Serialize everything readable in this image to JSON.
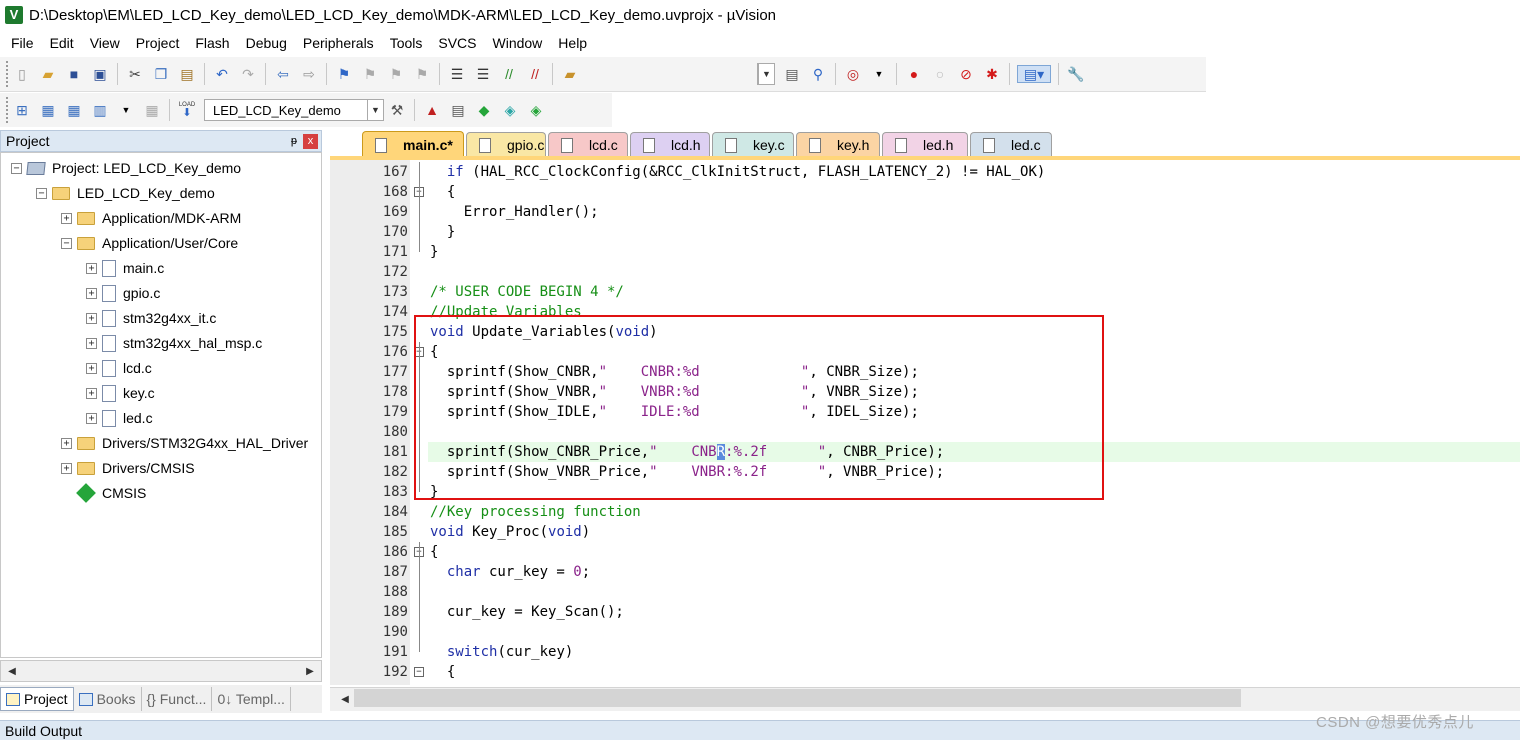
{
  "window": {
    "title": "D:\\Desktop\\EM\\LED_LCD_Key_demo\\LED_LCD_Key_demo\\MDK-ARM\\LED_LCD_Key_demo.uvprojx - µVision",
    "app_icon": "V"
  },
  "menu": [
    "File",
    "Edit",
    "View",
    "Project",
    "Flash",
    "Debug",
    "Peripherals",
    "Tools",
    "SVCS",
    "Window",
    "Help"
  ],
  "toolbar": {
    "target_name": "LED_LCD_Key_demo",
    "load_label": "LOAD"
  },
  "project_panel": {
    "title": "Project",
    "pin": "ᵽ",
    "close": "x",
    "tree": [
      {
        "label": "Project: LED_LCD_Key_demo",
        "expander": "−"
      },
      {
        "label": "LED_LCD_Key_demo",
        "expander": "−"
      },
      {
        "label": "Application/MDK-ARM",
        "expander": "+"
      },
      {
        "label": "Application/User/Core",
        "expander": "−"
      },
      {
        "label": "main.c",
        "expander": "+"
      },
      {
        "label": "gpio.c",
        "expander": "+"
      },
      {
        "label": "stm32g4xx_it.c",
        "expander": "+"
      },
      {
        "label": "stm32g4xx_hal_msp.c",
        "expander": "+"
      },
      {
        "label": "lcd.c",
        "expander": "+"
      },
      {
        "label": "key.c",
        "expander": "+"
      },
      {
        "label": "led.c",
        "expander": "+"
      },
      {
        "label": "Drivers/STM32G4xx_HAL_Driver",
        "expander": "+"
      },
      {
        "label": "Drivers/CMSIS",
        "expander": "+"
      },
      {
        "label": "CMSIS",
        "expander": ""
      }
    ],
    "bottom_tabs": [
      "Project",
      "Books",
      "{} Funct...",
      "0↓ Templ..."
    ]
  },
  "editor": {
    "tabs": [
      {
        "label": "main.c*",
        "color": "#ffd67a"
      },
      {
        "label": "gpio.c",
        "color": "#f9e7a5"
      },
      {
        "label": "lcd.c",
        "color": "#f7c8c8"
      },
      {
        "label": "lcd.h",
        "color": "#ddd0f2"
      },
      {
        "label": "key.c",
        "color": "#cfe8e5"
      },
      {
        "label": "key.h",
        "color": "#fbd4a4"
      },
      {
        "label": "led.h",
        "color": "#f2d3e6"
      },
      {
        "label": "led.c",
        "color": "#d3e0ec"
      }
    ],
    "lines": [
      {
        "num": "167",
        "text": "  if (HAL_RCC_ClockConfig(&RCC_ClkInitStruct, FLASH_LATENCY_2) != HAL_OK)"
      },
      {
        "num": "168",
        "text": "  {"
      },
      {
        "num": "169",
        "text": "    Error_Handler();"
      },
      {
        "num": "170",
        "text": "  }"
      },
      {
        "num": "171",
        "text": "}"
      },
      {
        "num": "172",
        "text": ""
      },
      {
        "num": "173",
        "text": "/* USER CODE BEGIN 4 */"
      },
      {
        "num": "174",
        "text": "//Update Variables"
      },
      {
        "num": "175",
        "text": "void Update_Variables(void)"
      },
      {
        "num": "176",
        "text": "{"
      },
      {
        "num": "177",
        "text": "  sprintf(Show_CNBR,\"    CNBR:%d            \", CNBR_Size);"
      },
      {
        "num": "178",
        "text": "  sprintf(Show_VNBR,\"    VNBR:%d            \", VNBR_Size);"
      },
      {
        "num": "179",
        "text": "  sprintf(Show_IDLE,\"    IDLE:%d            \", IDEL_Size);"
      },
      {
        "num": "180",
        "text": ""
      },
      {
        "num": "181",
        "text": "  sprintf(Show_CNBR_Price,\"    CNBR:%.2f      \", CNBR_Price);"
      },
      {
        "num": "182",
        "text": "  sprintf(Show_VNBR_Price,\"    VNBR:%.2f      \", VNBR_Price);"
      },
      {
        "num": "183",
        "text": "}"
      },
      {
        "num": "184",
        "text": "//Key processing function"
      },
      {
        "num": "185",
        "text": "void Key_Proc(void)"
      },
      {
        "num": "186",
        "text": "{"
      },
      {
        "num": "187",
        "text": "  char cur_key = 0;"
      },
      {
        "num": "188",
        "text": ""
      },
      {
        "num": "189",
        "text": "  cur_key = Key_Scan();"
      },
      {
        "num": "190",
        "text": ""
      },
      {
        "num": "191",
        "text": "  switch(cur_key)"
      },
      {
        "num": "192",
        "text": "  {"
      }
    ],
    "highlighted_line": "181"
  },
  "build_output": {
    "title": "Build Output"
  },
  "watermark": "CSDN @想要优秀点儿",
  "colors": {
    "highlight_box": "#e01111",
    "keyword": "#1f2fa6",
    "comment": "#168f16",
    "string": "#8a238a"
  }
}
